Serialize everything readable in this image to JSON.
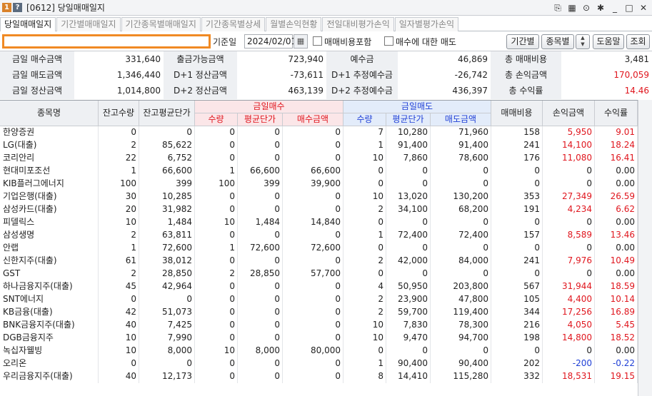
{
  "titlebar": {
    "badge1": "1",
    "badge2": "?",
    "title": "[0612] 당일매매일지",
    "ctrls": [
      "⎘",
      "▦",
      "⊙",
      "✱",
      "_",
      "□",
      "✕"
    ]
  },
  "tabs": [
    "당일매매일지",
    "기간별매매일지",
    "기간종목별매매일지",
    "기간종목별상세",
    "월별손익현황",
    "전일대비평가손익",
    "일자별평가손익"
  ],
  "toolbar": {
    "account_value": "",
    "base_label": "기준일",
    "date": "2024/02/01",
    "fee_include_label": "매매비용포함",
    "sell_for_buy_label": "매수에 대한 매도",
    "period_btn": "기간별",
    "stock_btn": "종목별",
    "help_btn": "도움말",
    "query_btn": "조회"
  },
  "summary": {
    "rows": [
      [
        {
          "label": "금일 매수금액",
          "value": "331,640",
          "color": ""
        },
        {
          "label": "출금가능금액",
          "value": "723,940",
          "color": ""
        },
        {
          "label": "예수금",
          "value": "46,869",
          "color": ""
        },
        {
          "label": "총 매매비용",
          "value": "3,481",
          "color": ""
        }
      ],
      [
        {
          "label": "금일 매도금액",
          "value": "1,346,440",
          "color": ""
        },
        {
          "label": "D+1 정산금액",
          "value": "-73,611",
          "color": ""
        },
        {
          "label": "D+1 추정예수금",
          "value": "-26,742",
          "color": ""
        },
        {
          "label": "총 손익금액",
          "value": "170,059",
          "color": "red"
        }
      ],
      [
        {
          "label": "금일 정산금액",
          "value": "1,014,800",
          "color": ""
        },
        {
          "label": "D+2 정산금액",
          "value": "463,139",
          "color": ""
        },
        {
          "label": "D+2 추정예수금",
          "value": "436,397",
          "color": ""
        },
        {
          "label": "총 수익률",
          "value": "14.46",
          "color": "red"
        }
      ]
    ]
  },
  "grid": {
    "headers": {
      "name": "종목명",
      "hold_qty": "잔고수량",
      "hold_avg": "잔고평균단가",
      "buy_group": "금일매수",
      "sell_group": "금일매도",
      "qty": "수량",
      "avg": "평균단가",
      "buy_amt": "매수금액",
      "sell_amt": "매도금액",
      "fee": "매매비용",
      "pnl": "손익금액",
      "ret": "수익률"
    },
    "rows": [
      [
        "한양증권",
        "0",
        "0",
        "0",
        "0",
        "0",
        "7",
        "10,280",
        "71,960",
        "158",
        "5,950",
        "9.01"
      ],
      [
        "LG(대출)",
        "2",
        "85,622",
        "0",
        "0",
        "0",
        "1",
        "91,400",
        "91,400",
        "241",
        "14,100",
        "18.24"
      ],
      [
        "코리안리",
        "22",
        "6,752",
        "0",
        "0",
        "0",
        "10",
        "7,860",
        "78,600",
        "176",
        "11,080",
        "16.41"
      ],
      [
        "현대미포조선",
        "1",
        "66,600",
        "1",
        "66,600",
        "66,600",
        "0",
        "0",
        "0",
        "0",
        "0",
        "0.00"
      ],
      [
        "KIB플러그에너지",
        "100",
        "399",
        "100",
        "399",
        "39,900",
        "0",
        "0",
        "0",
        "0",
        "0",
        "0.00"
      ],
      [
        "기업은행(대출)",
        "30",
        "10,285",
        "0",
        "0",
        "0",
        "10",
        "13,020",
        "130,200",
        "353",
        "27,349",
        "26.59"
      ],
      [
        "삼성카드(대출)",
        "20",
        "31,982",
        "0",
        "0",
        "0",
        "2",
        "34,100",
        "68,200",
        "191",
        "4,234",
        "6.62"
      ],
      [
        "피델릭스",
        "10",
        "1,484",
        "10",
        "1,484",
        "14,840",
        "0",
        "0",
        "0",
        "0",
        "0",
        "0.00"
      ],
      [
        "삼성생명",
        "2",
        "63,811",
        "0",
        "0",
        "0",
        "1",
        "72,400",
        "72,400",
        "157",
        "8,589",
        "13.46"
      ],
      [
        "안랩",
        "1",
        "72,600",
        "1",
        "72,600",
        "72,600",
        "0",
        "0",
        "0",
        "0",
        "0",
        "0.00"
      ],
      [
        "신한지주(대출)",
        "61",
        "38,012",
        "0",
        "0",
        "0",
        "2",
        "42,000",
        "84,000",
        "241",
        "7,976",
        "10.49"
      ],
      [
        "GST",
        "2",
        "28,850",
        "2",
        "28,850",
        "57,700",
        "0",
        "0",
        "0",
        "0",
        "0",
        "0.00"
      ],
      [
        "하나금융지주(대출)",
        "45",
        "42,964",
        "0",
        "0",
        "0",
        "4",
        "50,950",
        "203,800",
        "567",
        "31,944",
        "18.59"
      ],
      [
        "SNT에너지",
        "0",
        "0",
        "0",
        "0",
        "0",
        "2",
        "23,900",
        "47,800",
        "105",
        "4,400",
        "10.14"
      ],
      [
        "KB금융(대출)",
        "42",
        "51,073",
        "0",
        "0",
        "0",
        "2",
        "59,700",
        "119,400",
        "344",
        "17,256",
        "16.89"
      ],
      [
        "BNK금융지주(대출)",
        "40",
        "7,425",
        "0",
        "0",
        "0",
        "10",
        "7,830",
        "78,300",
        "216",
        "4,050",
        "5.45"
      ],
      [
        "DGB금융지주",
        "10",
        "7,990",
        "0",
        "0",
        "0",
        "10",
        "9,470",
        "94,700",
        "198",
        "14,800",
        "18.52"
      ],
      [
        "녹십자웰빙",
        "10",
        "8,000",
        "10",
        "8,000",
        "80,000",
        "0",
        "0",
        "0",
        "0",
        "0",
        "0.00"
      ],
      [
        "오리온",
        "0",
        "0",
        "0",
        "0",
        "0",
        "1",
        "90,400",
        "90,400",
        "202",
        "-200",
        "-0.22"
      ],
      [
        "우리금융지주(대출)",
        "40",
        "12,173",
        "0",
        "0",
        "0",
        "8",
        "14,410",
        "115,280",
        "332",
        "18,531",
        "19.15"
      ]
    ]
  },
  "colors": {
    "accent_orange": "#f08a24",
    "positive": "#e0161e",
    "negative": "#1f3fd6"
  }
}
